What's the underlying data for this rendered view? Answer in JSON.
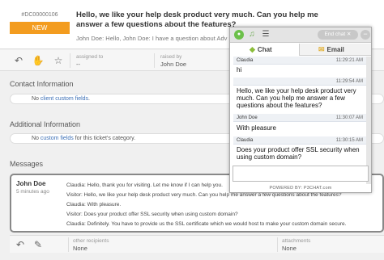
{
  "ticket": {
    "id": "#DC00000106",
    "status": "NEW",
    "subject": "Hello, we like your help desk product very much. Can you help me answer a few questions about the features?",
    "preview": "John Doe: Hello, John Doe: I have a question about Adv",
    "assigned_label": "assigned to",
    "assigned_value": "--",
    "raised_label": "raised by",
    "raised_value": "John Doe"
  },
  "sections": {
    "contact_title": "Contact Information",
    "contact_text_pre": "No ",
    "contact_link": "client custom fields",
    "contact_text_post": ".",
    "additional_title": "Additional Information",
    "additional_text_pre": "No ",
    "additional_link": "custom fields",
    "additional_text_post": " for this ticket's category.",
    "messages_title": "Messages"
  },
  "message": {
    "author": "John Doe",
    "time": "5 minutes ago",
    "lines": [
      "Claudia: Hello, thank you for visiting. Let me know if I can help you.",
      "Visitor: Hello, we like your help desk product very much. Can you help me answer a few questions about the features?",
      "Claudia: With pleasure.",
      "Visitor: Does your product offer SSL security when using custom domain?",
      "Claudia: Definitely. You have to provide us the SSL certificate which we would host to make your custom domain secure."
    ]
  },
  "bottom_bar": {
    "recipients_label": "other recipients",
    "recipients_value": "None",
    "attachments_label": "attachments",
    "attachments_value": "None"
  },
  "chat": {
    "end_chat_label": "End chat",
    "min_label": "−",
    "tab_chat": "Chat",
    "tab_email": "Email",
    "messages": [
      {
        "name": "Claudia",
        "time": "11:29:21 AM",
        "text": "hi"
      },
      {
        "name": "",
        "time": "11:29:54 AM",
        "text": "Hello, we like your help desk product very much. Can you help me answer a few questions about the features?"
      },
      {
        "name": "John Doe",
        "time": "11:30:07 AM",
        "text": "With pleasure"
      },
      {
        "name": "Claudia",
        "time": "11:30:15 AM",
        "text": "Does your product offer SSL security when using custom domain?"
      }
    ],
    "footer": "POWERED BY: P3CHAT.com"
  },
  "icons": {
    "reply": "reply-icon",
    "forward": "hand-icon",
    "star": "star-icon",
    "edit": "pencil-icon",
    "online": "online-status-icon",
    "sound": "music-note-icon",
    "menu": "menu-icon",
    "chat_tab": "chat-bubble-icon",
    "email_tab": "envelope-icon"
  },
  "colors": {
    "status_new": "#f39c1f",
    "link": "#3b6fb6",
    "online": "#6cc04a"
  }
}
